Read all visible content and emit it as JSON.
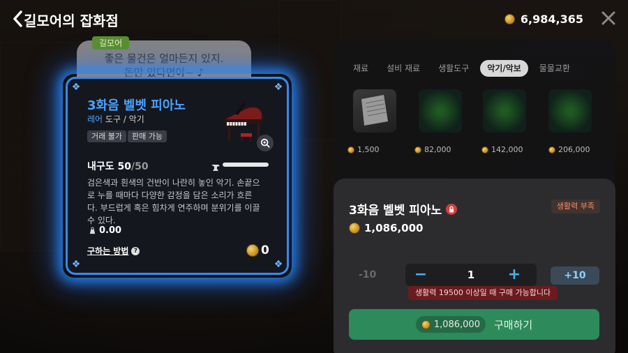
{
  "header": {
    "title": "길모어의 잡화점",
    "coin_balance": "6,984,365"
  },
  "npc": {
    "name": "길모어",
    "speech_line1": "좋은 물건은 얼마든지 있지.",
    "speech_line2": "돈만 있다면야~ ♪"
  },
  "item_card": {
    "name": "3화음 벨벳 피아노",
    "rarity": "레어",
    "category": "도구 / 악기",
    "tags": [
      "거래 불가",
      "판매 가능"
    ],
    "durability_label": "내구도 50",
    "durability_max": "/50",
    "durability_fraction": 1.0,
    "description": "검은색과 흰색의 건반이 나란히 놓인 악기. 손끝으로 누를 때마다 다양한 감정을 담은 소리가 흐른다. 부드럽게 혹은 힘차게 연주하며 분위기를 이끌 수 있다.",
    "weight": "0.00",
    "how_to_get": "구하는 방법",
    "sell_price": "0"
  },
  "shop": {
    "tabs": [
      {
        "label": "재료",
        "active": false
      },
      {
        "label": "설비 재료",
        "active": false
      },
      {
        "label": "생활도구",
        "active": false
      },
      {
        "label": "악기/악보",
        "active": true
      },
      {
        "label": "물물교환",
        "active": false
      }
    ],
    "item_prices": [
      "1,500",
      "82,000",
      "142,000",
      "206,000"
    ]
  },
  "purchase": {
    "item_name": "3화음 벨벳 피아노",
    "warning": "생활력 부족",
    "price": "1,086,000",
    "minus10": "-10",
    "quantity": "1",
    "plus10": "+10",
    "requirement_tooltip": "생활력 19500 이상일 때 구매 가능합니다",
    "total": "1,086,000",
    "buy_label": "구매하기"
  },
  "colors": {
    "card_border": "#2f8cff",
    "rare_text": "#4aa3ff",
    "buy_button": "#2d8a5a",
    "warning_text": "#ff8a65",
    "tooltip_bg": "#6b1b1e"
  }
}
